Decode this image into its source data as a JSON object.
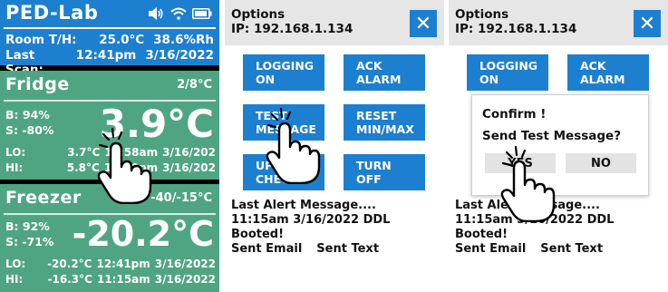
{
  "main": {
    "title": "PED-Lab",
    "room_label": "Room T/H:",
    "room_temp": "25.0°C",
    "room_humidity": "38.6%Rh",
    "scan_label": "Last Scan:",
    "scan_time": "12:41pm",
    "scan_date": "3/16/2022",
    "zones": [
      {
        "name": "Fridge",
        "range": "2/8°C",
        "battery": "B: 94%",
        "signal": "S: -80%",
        "temp": "3.9°C",
        "lo_label": "LO:",
        "lo_value": "3.7°C",
        "lo_time": "11:58am",
        "lo_date": "3/16/202",
        "hi_label": "HI:",
        "hi_value": "5.8°C",
        "hi_time": "12:00pm",
        "hi_date": "3/16/202"
      },
      {
        "name": "Freezer",
        "range": "-40/-15°C",
        "battery": "B: 92%",
        "signal": "S: -71%",
        "temp": "-20.2°C",
        "lo_label": "LO:",
        "lo_value": "-20.2°C",
        "lo_time": "12:41pm",
        "lo_date": "3/16/2022",
        "hi_label": "HI:",
        "hi_value": "-16.3°C",
        "hi_time": "11:15am",
        "hi_date": "3/16/2022"
      }
    ],
    "icons": [
      "volume-icon",
      "wifi-icon",
      "battery-icon"
    ]
  },
  "options": {
    "title": "Options",
    "ip": "IP: 192.168.1.134",
    "close": "✕",
    "buttons": [
      {
        "line1": "LOGGING",
        "line2": "ON"
      },
      {
        "line1": "ACK",
        "line2": "ALARM"
      },
      {
        "line1": "TEST",
        "line2": "MESSAGE"
      },
      {
        "line1": "RESET",
        "line2": "MIN/MAX"
      },
      {
        "line1": "UPDATE",
        "line2": "CHECK"
      },
      {
        "line1": "TURN",
        "line2": "OFF"
      }
    ],
    "last_alert_label": "Last Alert Message....",
    "last_alert": "11:15am 3/16/2022 DDL Booted!",
    "sent_email": "Sent Email",
    "sent_text": "Sent Text"
  },
  "confirm": {
    "title": "Confirm !",
    "question": "Send Test Message?",
    "yes": "YES",
    "no": "NO"
  },
  "colors": {
    "header_blue": "#1d7fd0",
    "zone_green": "#4fa582",
    "button_blue": "#1d7fd0",
    "header_gray": "#e6e6e6"
  }
}
